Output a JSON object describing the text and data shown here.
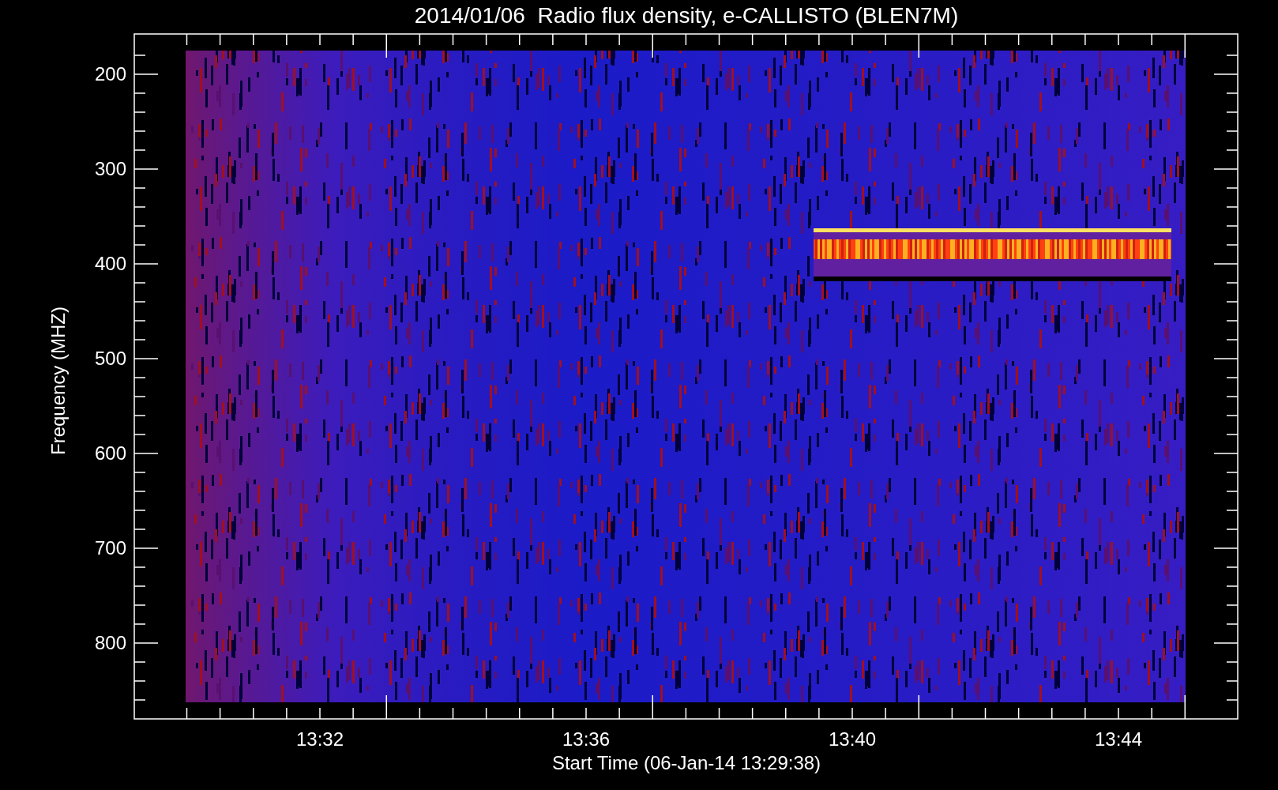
{
  "title": "2014/01/06  Radio flux density, e-CALLISTO (BLEN7M)",
  "y_axis": {
    "label": "Frequency (MHZ)",
    "ticks": [
      "200",
      "300",
      "400",
      "500",
      "600",
      "700",
      "800"
    ]
  },
  "x_axis": {
    "label": "Start Time (06-Jan-14 13:29:38)",
    "ticks": [
      "13:32",
      "13:36",
      "13:40",
      "13:44"
    ]
  }
}
